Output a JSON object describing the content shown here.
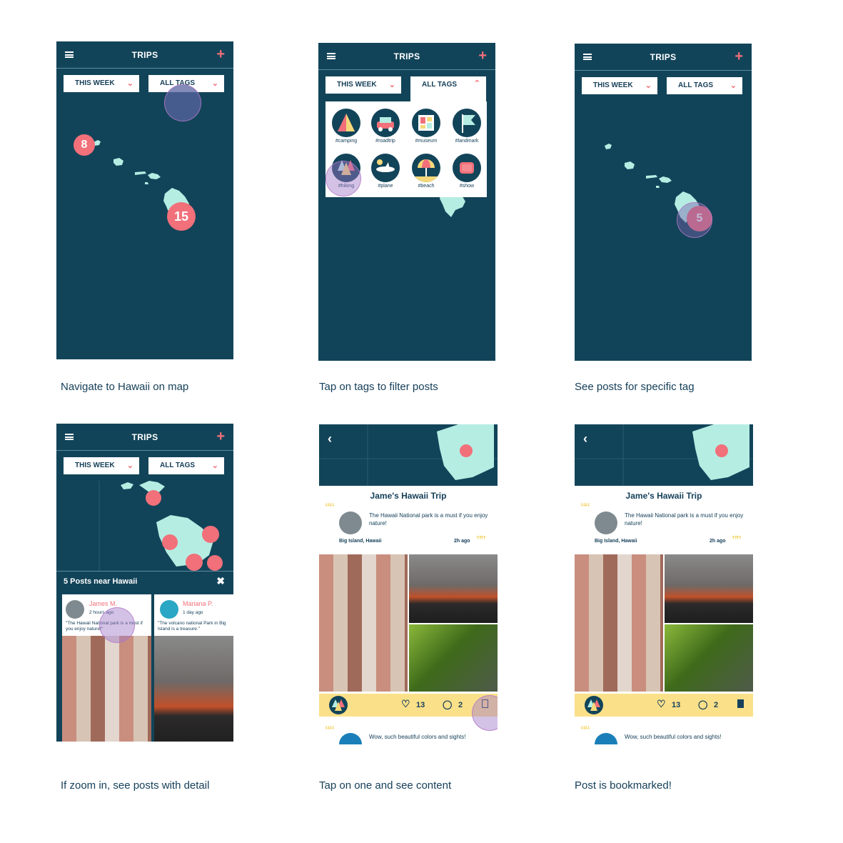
{
  "colors": {
    "navy": "#124459",
    "coral": "#f1707a",
    "island": "#b5ede3",
    "yellow": "#fbe08a"
  },
  "nav": {
    "title": "TRIPS",
    "add_icon": "plus-icon",
    "menu_icon": "hamburger-icon"
  },
  "filters": {
    "time": "THIS WEEK",
    "tags": "ALL TAGS"
  },
  "screen1": {
    "clusters": [
      {
        "count": "8"
      },
      {
        "count": "15"
      }
    ],
    "caption": "Navigate to Hawaii on map"
  },
  "screen2": {
    "tags": [
      {
        "label": "#camping",
        "icon": "tent-icon"
      },
      {
        "label": "#roadtrip",
        "icon": "car-icon"
      },
      {
        "label": "#museum",
        "icon": "museum-icon"
      },
      {
        "label": "#landmark",
        "icon": "flag-icon"
      },
      {
        "label": "#hiking",
        "icon": "trees-icon"
      },
      {
        "label": "#plane",
        "icon": "plane-icon"
      },
      {
        "label": "#beach",
        "icon": "umbrella-icon"
      },
      {
        "label": "#show",
        "icon": "show-icon"
      }
    ],
    "caption": "Tap on tags to filter posts"
  },
  "screen3": {
    "cluster": "5",
    "caption": "See posts for specific tag"
  },
  "screen4": {
    "sheet_title": "5 Posts near Hawaii",
    "cards": [
      {
        "name": "James M.",
        "time": "2 hours ago",
        "quote": "\"The Hawaii National park is a must if you enjoy nature!\""
      },
      {
        "name": "Mariana P.",
        "time": "1 day ago",
        "quote": "\"The volcano national Park in Big Island is a treasure.\""
      }
    ],
    "caption": "If zoom in, see posts with detail"
  },
  "post": {
    "title": "Jame's Hawaii Trip",
    "quote": "The Hawaii National park is a must if you enjoy nature!",
    "location": "Big Island, Hawaii",
    "time": "2h ago",
    "likes": "13",
    "comments": "2",
    "comment_text": "Wow, such beautiful colors and sights!"
  },
  "screen5": {
    "caption": "Tap on one and see content"
  },
  "screen6": {
    "caption": "Post is bookmarked!"
  }
}
